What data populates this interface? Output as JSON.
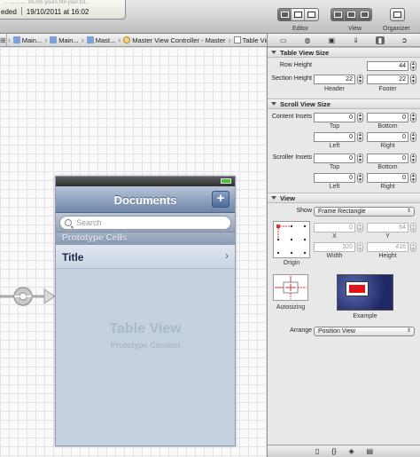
{
  "toolbar": {
    "status_path_faint": "...............   rm.hm  yours.hm  your.fol...",
    "status_ended": "eded",
    "status_datetime": "19/10/2011 at 16:02",
    "editor_label": "Editor",
    "view_label": "View",
    "organizer_label": "Organizer"
  },
  "jumpbar": {
    "crumbs": [
      "Main...",
      "Main...",
      "Mast...",
      "Master View Controller - Master",
      "Table View"
    ]
  },
  "scene": {
    "nav_title": "Documents",
    "add_button": "+",
    "search_placeholder": "Search",
    "section_header": "Prototype Cells",
    "cell_title": "Title",
    "cell_chevron": "›",
    "table_view_label": "Table View",
    "table_view_sub": "Prototype Content"
  },
  "inspector": {
    "table_view_size": {
      "heading": "Table View Size",
      "row_height_label": "Row Height",
      "row_height": "44",
      "section_height_label": "Section Height",
      "header_value": "22",
      "footer_value": "22",
      "header_label": "Header",
      "footer_label": "Footer"
    },
    "scroll_view_size": {
      "heading": "Scroll View Size",
      "content_insets_label": "Content Insets",
      "scroller_insets_label": "Scroller Insets",
      "top_label": "Top",
      "bottom_label": "Bottom",
      "left_label": "Left",
      "right_label": "Right",
      "content_top": "0",
      "content_bottom": "0",
      "content_left": "0",
      "content_right": "0",
      "scroller_top": "0",
      "scroller_bottom": "0",
      "scroller_left": "0",
      "scroller_right": "0"
    },
    "view": {
      "heading": "View",
      "show_label": "Show",
      "show_value": "Frame Rectangle",
      "x_value": "0",
      "y_value": "64",
      "x_label": "X",
      "y_label": "Y",
      "width_value": "320",
      "height_value": "416",
      "width_label": "Width",
      "height_label": "Height",
      "origin_label": "Origin",
      "autosizing_label": "Autosizing",
      "example_label": "Example",
      "arrange_label": "Arrange",
      "arrange_value": "Position View"
    }
  }
}
